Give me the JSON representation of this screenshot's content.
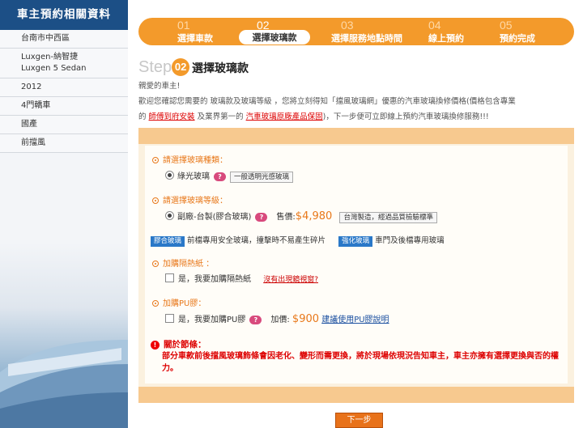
{
  "sidebar": {
    "title": "車主預約相關資料",
    "items": [
      "台南市中西區",
      "Luxgen-納智捷\nLuxgen 5 Sedan",
      "2012",
      "4門轎車",
      "國產",
      "前擋風"
    ]
  },
  "steps": [
    {
      "num": "01",
      "label": "選擇車款"
    },
    {
      "num": "02",
      "label": "選擇玻璃款"
    },
    {
      "num": "03",
      "label": "選擇服務地點時間"
    },
    {
      "num": "04",
      "label": "線上預約"
    },
    {
      "num": "05",
      "label": "預約完成"
    }
  ],
  "heading": {
    "step_text": "Step",
    "step_num": "02",
    "title": "選擇玻璃款"
  },
  "greeting": "親愛的車主!",
  "intro": {
    "line1": "歡迎您確認您需要的 玻璃款及玻璃等級 ，您將立刻得知「擋風玻璃網」優惠的汽車玻璃換修價格(價格包含專業",
    "pre_link1": "的 ",
    "link1": "師傅到府安裝",
    "mid": " 及業界第一的 ",
    "link2": "汽車玻璃原廠產品保固",
    "post": ")，下一步便可立即線上預約汽車玻璃換修服務!!!"
  },
  "q1": {
    "label": "請選擇玻璃種類：",
    "option": "綠光玻璃",
    "help": "?",
    "tag": "一般透明光感玻璃"
  },
  "q2": {
    "label": "請選擇玻璃等級：",
    "option": "副廠-台製(膠合玻璃)",
    "help": "?",
    "price_label": "售價:",
    "price": "$4,980",
    "tag": "台灣製造，經過品質檢驗標準"
  },
  "glass_info": {
    "tag1": "膠合玻璃",
    "desc1": "前檔專用安全玻璃，撞擊時不易產生碎片",
    "tag2": "強化玻璃",
    "desc2": "車門及後檔專用玻璃"
  },
  "q3": {
    "label": "加購隔熱紙 ：",
    "option": "是，我要加購隔熱紙",
    "link": "沒有出現鏡視窗?"
  },
  "q4": {
    "label": "加購PU膠：",
    "option": "是，我要加購PU膠",
    "help": "?",
    "price_label": "加價:",
    "price": "$900",
    "link": "建議使用PU膠說明"
  },
  "note": {
    "icon": "!",
    "title": "關於節條：",
    "body": "部分車款前後擋風玻璃飾條會因老化、變形而需更換，將於現場依現況告知車主，車主亦擁有選擇更換與否的權力。"
  },
  "next_button": "下一步",
  "colors": {
    "accent": "#f39a2b",
    "sidebar_title": "#1c4f86",
    "warning": "#dd0000"
  }
}
